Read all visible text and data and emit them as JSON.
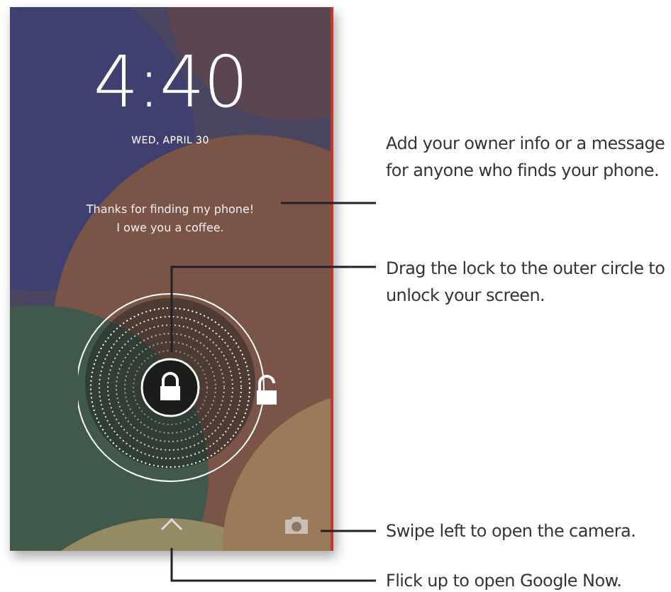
{
  "lock_screen": {
    "time": "4:40",
    "date": "WED, APRIL 30",
    "owner_message": [
      "Thanks for finding my phone!",
      "I owe you a coffee."
    ]
  },
  "callouts": [
    {
      "text": "Add your owner info or a message for anyone who finds your phone."
    },
    {
      "text": "Drag the lock to the outer circle to unlock your screen."
    },
    {
      "text": "Swipe left to open the camera."
    },
    {
      "text": "Flick up to open Google Now."
    }
  ]
}
